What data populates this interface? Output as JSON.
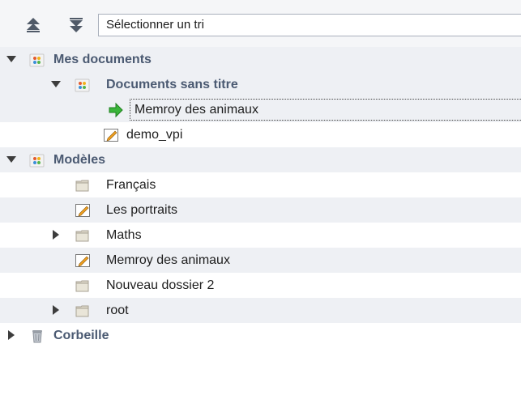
{
  "toolbar": {
    "move_up_icon": "double-chevron-up-icon",
    "move_down_icon": "double-chevron-down-icon",
    "sort_select": {
      "selected": "Sélectionner un tri"
    }
  },
  "tree": {
    "rows": [
      {
        "label": "Mes documents",
        "expanded": true
      },
      {
        "label": "Documents sans titre",
        "expanded": true
      },
      {
        "label": "Memroy des animaux"
      },
      {
        "label": "demo_vpi"
      },
      {
        "label": "Modèles",
        "expanded": true
      },
      {
        "label": "Français"
      },
      {
        "label": "Les portraits"
      },
      {
        "label": "Maths",
        "expanded": false
      },
      {
        "label": "Memroy des animaux"
      },
      {
        "label": "Nouveau dossier 2"
      },
      {
        "label": "root",
        "expanded": false
      },
      {
        "label": "Corbeille",
        "expanded": false
      }
    ]
  },
  "colors": {
    "group_text": "#4b5a72",
    "row_shade": "#eef0f4",
    "toolbar_bg": "#f5f6f8",
    "folder": "#d9d4c4",
    "arrow_green": "#3ab43a"
  }
}
